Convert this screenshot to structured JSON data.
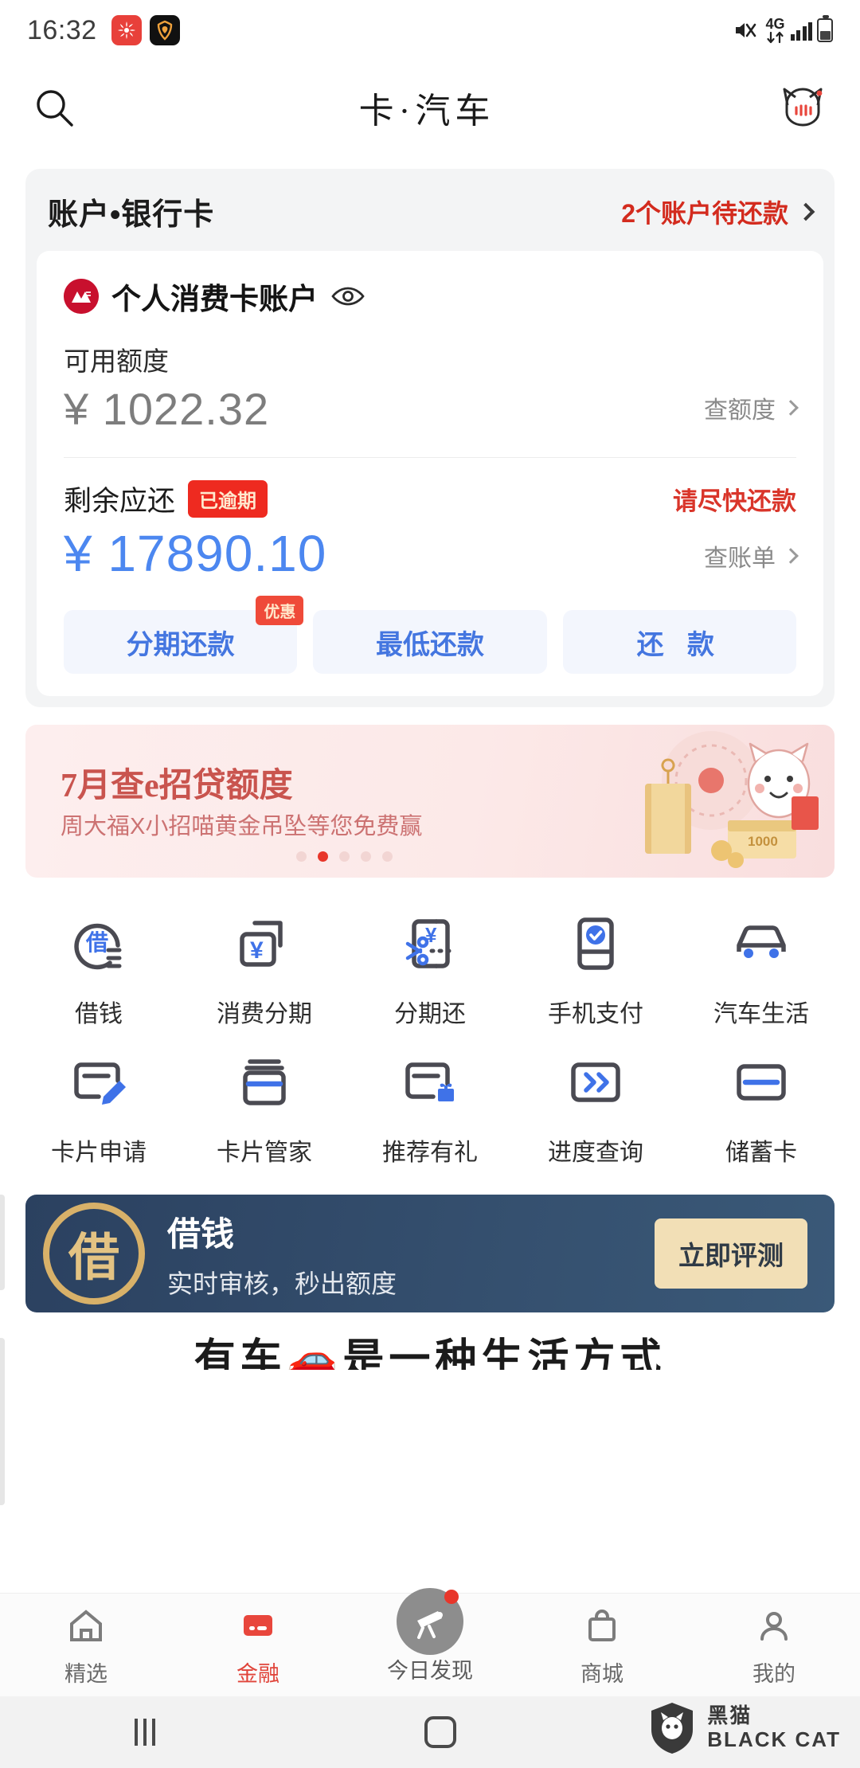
{
  "status_bar": {
    "time": "16:32",
    "network": "4G",
    "icons": [
      "app-badge-red",
      "app-badge-dark",
      "mute-icon",
      "data-arrows-icon",
      "signal-bars-icon",
      "battery-icon"
    ]
  },
  "app_header": {
    "title": "卡·汽车",
    "search_icon": "search-icon",
    "mascot_icon": "cat-mascot-icon"
  },
  "account_section": {
    "title": "账户•银行卡",
    "alert_text": "2个账户待还款",
    "alert_color": "#d32b1e",
    "card": {
      "bank_logo": "cmb-logo",
      "account_name": "个人消费卡账户",
      "eye_icon": "eye-icon",
      "available_label": "可用额度",
      "available_amount": "¥ 1022.32",
      "available_link": "查额度",
      "due_label": "剩余应还",
      "due_badge": "已逾期",
      "due_warning": "请尽快还款",
      "due_amount": "¥ 17890.10",
      "due_amount_color": "#4c87f0",
      "due_link": "查账单",
      "buttons": [
        {
          "label": "分期还款",
          "badge": "优惠"
        },
        {
          "label": "最低还款",
          "badge": ""
        },
        {
          "label": "还 款",
          "badge": ""
        }
      ]
    }
  },
  "promo_banner": {
    "title": "7月查e招贷额度",
    "subtitle": "周大福X小招喵黄金吊坠等您免费赢",
    "dot_count": 5,
    "active_dot": 1
  },
  "icon_grid": {
    "rows": [
      [
        {
          "label": "借钱",
          "icon": "borrow-money-icon"
        },
        {
          "label": "消费分期",
          "icon": "installment-icon"
        },
        {
          "label": "分期还",
          "icon": "split-repay-icon"
        },
        {
          "label": "手机支付",
          "icon": "mobile-pay-icon"
        },
        {
          "label": "汽车生活",
          "icon": "car-life-icon"
        }
      ],
      [
        {
          "label": "卡片申请",
          "icon": "card-apply-icon"
        },
        {
          "label": "卡片管家",
          "icon": "card-manager-icon"
        },
        {
          "label": "推荐有礼",
          "icon": "referral-gift-icon"
        },
        {
          "label": "进度查询",
          "icon": "progress-query-icon"
        },
        {
          "label": "储蓄卡",
          "icon": "debit-card-icon"
        }
      ]
    ]
  },
  "loan_banner": {
    "seal_text": "借",
    "title": "借钱",
    "subtitle": "实时审核，秒出额度",
    "button": "立即评测"
  },
  "teaser_text": "有车🚗是一种生活方式",
  "tab_bar": {
    "items": [
      {
        "label": "精选",
        "icon": "home-icon",
        "active": false
      },
      {
        "label": "金融",
        "icon": "card-icon",
        "active": true
      },
      {
        "label": "今日发现",
        "icon": "telescope-icon",
        "active": false,
        "badge": true
      },
      {
        "label": "商城",
        "icon": "bag-icon",
        "active": false
      },
      {
        "label": "我的",
        "icon": "person-icon",
        "active": false
      }
    ],
    "active_color": "#e0443a"
  },
  "nav_bar": {
    "recent_icon": "recents-icon",
    "home_icon": "home-square-icon",
    "back_icon": "back-icon"
  },
  "watermark": {
    "line1": "黑猫",
    "line2": "BLACK CAT",
    "shield_icon": "shield-cat-icon"
  }
}
